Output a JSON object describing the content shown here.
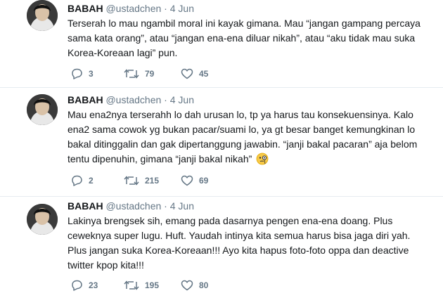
{
  "tweets": [
    {
      "name": "BABAH",
      "handle": "@ustadchen",
      "separator": "·",
      "date": "4 Jun",
      "text": "Terserah lo mau ngambil moral ini kayak gimana. Mau “jangan gampang percaya sama kata orang”, atau “jangan ena-ena diluar nikah”, atau “aku tidak mau suka Korea-Koreaan lagi” pun.",
      "replies": "3",
      "retweets": "79",
      "likes": "45"
    },
    {
      "name": "BABAH",
      "handle": "@ustadchen",
      "separator": "·",
      "date": "4 Jun",
      "text": "Mau ena2nya terserahh lo dah urusan lo, tp ya harus tau konsekuensinya. Kalo ena2 sama cowok yg bukan pacar/suami lo, ya gt besar banget kemungkinan lo bakal ditinggalin dan gak dipertanggung jawabin. “janji bakal pacaran” aja belom tentu dipenuhin, gimana “janji bakal nikah”",
      "emoji": "face-with-monocle",
      "replies": "2",
      "retweets": "215",
      "likes": "69"
    },
    {
      "name": "BABAH",
      "handle": "@ustadchen",
      "separator": "·",
      "date": "4 Jun",
      "text": "Lakinya brengsek sih, emang pada dasarnya pengen ena-ena doang. Plus ceweknya super lugu. Huft. Yaudah intinya kita semua harus bisa jaga diri yah. Plus jangan suka Korea-Koreaan!!! Ayo kita hapus foto-foto oppa dan deactive twitter kpop kita!!!",
      "replies": "23",
      "retweets": "195",
      "likes": "80"
    }
  ],
  "icons": {
    "reply": "reply-icon",
    "retweet": "retweet-icon",
    "like": "heart-icon"
  },
  "colors": {
    "text": "#14171a",
    "muted": "#657786",
    "separator": "#e6ecf0"
  }
}
